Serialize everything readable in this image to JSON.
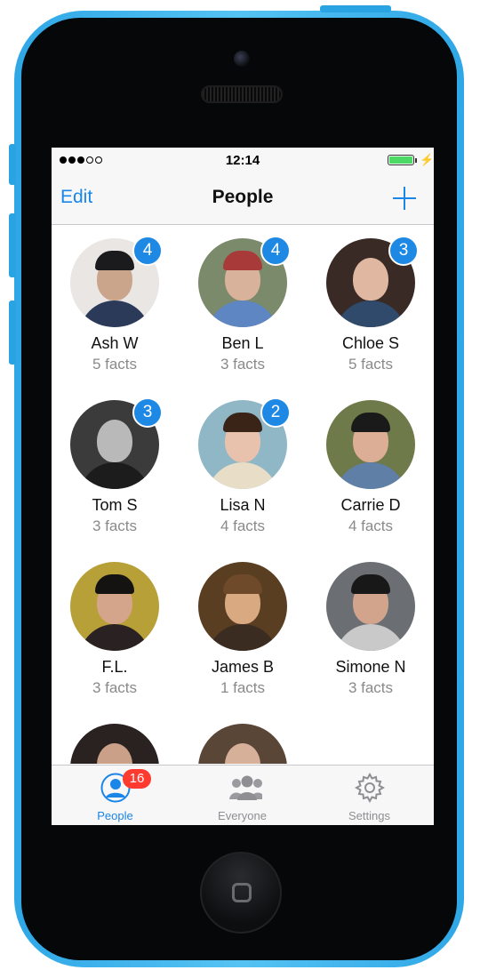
{
  "status_bar": {
    "time": "12:14"
  },
  "nav": {
    "left_label": "Edit",
    "title": "People"
  },
  "people": [
    {
      "name": "Ash W",
      "facts": "5 facts",
      "badge": "4"
    },
    {
      "name": "Ben L",
      "facts": "3 facts",
      "badge": "4"
    },
    {
      "name": "Chloe S",
      "facts": "5 facts",
      "badge": "3"
    },
    {
      "name": "Tom S",
      "facts": "3 facts",
      "badge": "3"
    },
    {
      "name": "Lisa N",
      "facts": "4 facts",
      "badge": "2"
    },
    {
      "name": "Carrie D",
      "facts": "4 facts",
      "badge": ""
    },
    {
      "name": "F.L.",
      "facts": "3 facts",
      "badge": ""
    },
    {
      "name": "James B",
      "facts": "1 facts",
      "badge": ""
    },
    {
      "name": "Simone N",
      "facts": "3 facts",
      "badge": ""
    }
  ],
  "tabs": [
    {
      "label": "People",
      "badge": "16",
      "icon": "person-icon",
      "active": true
    },
    {
      "label": "Everyone",
      "icon": "group-icon",
      "active": false
    },
    {
      "label": "Settings",
      "icon": "gear-icon",
      "active": false
    }
  ],
  "colors": {
    "accent": "#1a86e8",
    "badge_blue": "#1e88e5",
    "badge_red": "#ff3b30",
    "phone_body": "#3fb4ee"
  }
}
